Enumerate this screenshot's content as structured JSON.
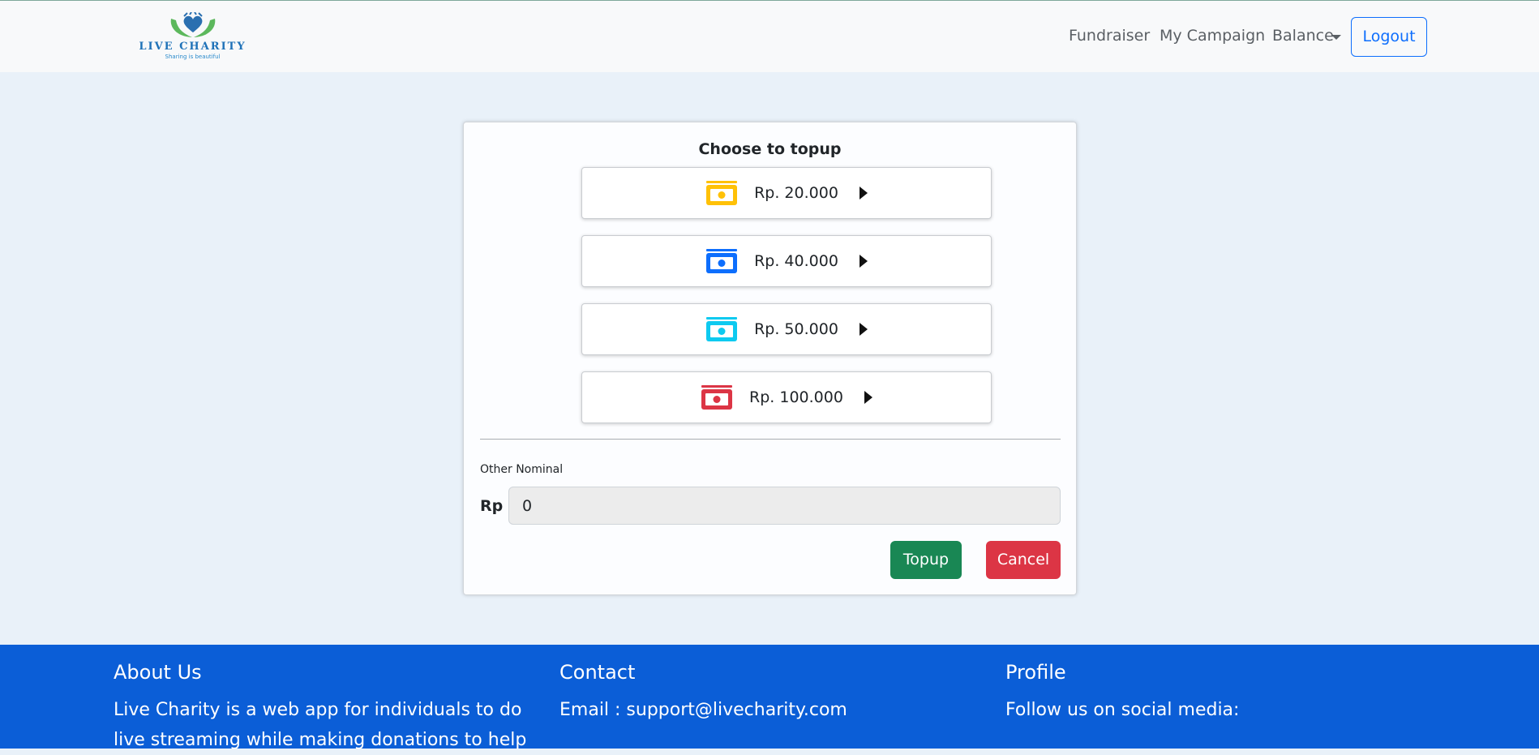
{
  "navbar": {
    "brand": {
      "name": "LIVE CHARITY",
      "tagline": "Sharing is beautiful"
    },
    "links": {
      "fundraiser": "Fundraiser",
      "my_campaign": "My Campaign",
      "balance": "Balance"
    },
    "logout_label": "Logout"
  },
  "topup": {
    "title": "Choose to topup",
    "options": [
      {
        "label": "Rp. 20.000",
        "icon": "money-icon",
        "color": "#ffc107"
      },
      {
        "label": "Rp. 40.000",
        "icon": "money-icon",
        "color": "#0d6efd"
      },
      {
        "label": "Rp. 50.000",
        "icon": "money-icon",
        "color": "#0dcaf0"
      },
      {
        "label": "Rp. 100.000",
        "icon": "money-icon",
        "color": "#dc3545"
      }
    ],
    "other_nominal_label": "Other Nominal",
    "currency_prefix": "Rp",
    "nominal_value": "0",
    "topup_button": "Topup",
    "cancel_button": "Cancel"
  },
  "footer": {
    "about": {
      "heading": "About Us",
      "text": "Live Charity is a web app for individuals to do live streaming while making donations to help"
    },
    "contact": {
      "heading": "Contact",
      "email": "Email : support@livecharity.com"
    },
    "profile": {
      "heading": "Profile",
      "text": "Follow us on social media:"
    }
  },
  "colors": {
    "primary": "#0d6efd",
    "success": "#198754",
    "danger": "#dc3545",
    "footer_bg": "#0b5ed7",
    "page_bg": "#e9f1f9"
  }
}
